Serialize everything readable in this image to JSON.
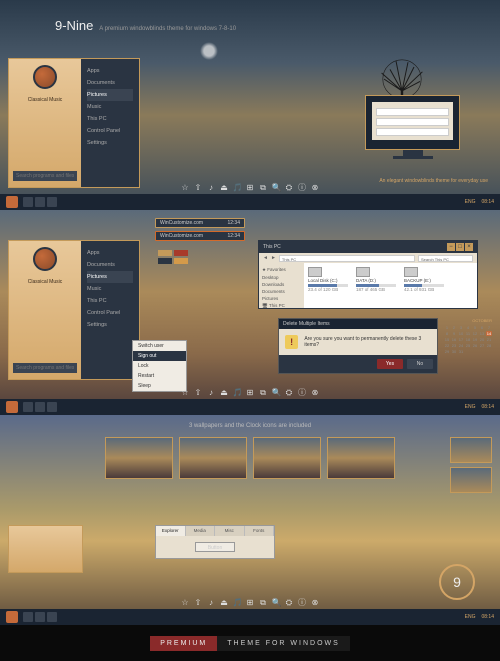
{
  "product": {
    "name": "9-Nine",
    "subtitle": "A premium windowblinds theme for windows 7-8-10"
  },
  "tagline": "An elegant windowblinds theme for everyday use",
  "startmenu": {
    "username": "Classical Music",
    "search_ph": "Search programs and files",
    "items": [
      "Apps",
      "Documents",
      "Pictures",
      "Music",
      "This PC",
      "Control Panel",
      "Settings"
    ]
  },
  "taskbar": {
    "time": "08:14",
    "lang": "ENG",
    "date_short": ""
  },
  "dock": [
    "☆",
    "⇧",
    "♪",
    "⏏",
    "🎵",
    "⊞",
    "⧉",
    "🔍",
    "⛭",
    "ⓘ",
    "⊗"
  ],
  "tabs": [
    {
      "label": "WinCustomize.com",
      "t": "12:34"
    },
    {
      "label": "WinCustomize.com",
      "t": "12:34"
    }
  ],
  "swatches": [
    [
      "#c49a5a",
      "#a83a2a"
    ],
    [
      "#2a3442",
      "#d49a4a"
    ]
  ],
  "explorer": {
    "title": "This PC",
    "address": "This PC",
    "search_ph": "Search This PC",
    "side": [
      "★ Favorites",
      "Desktop",
      "Downloads",
      "Documents",
      "Pictures",
      "🖥 This PC"
    ],
    "drives": [
      {
        "name": "Local Disk (C:)",
        "free": "23.4 of 120 GB",
        "fill": 72
      },
      {
        "name": "DATA (D:)",
        "free": "187 of 465 GB",
        "fill": 58
      },
      {
        "name": "BACKUP (E:)",
        "free": "42.1 of 931 GB",
        "fill": 45
      }
    ]
  },
  "dialog": {
    "title": "Delete Multiple Items",
    "msg": "Are you sure you want to permanently delete these 3 items?",
    "yes": "Yes",
    "no": "No"
  },
  "context": [
    "Switch user",
    "Sign out",
    "Lock",
    "Restart",
    "Sleep"
  ],
  "calendar": {
    "month": "OCTOBER",
    "days": [
      "1",
      "2",
      "3",
      "4",
      "5",
      "6",
      "7",
      "8",
      "9",
      "10",
      "11",
      "12",
      "13",
      "14",
      "15",
      "16",
      "17",
      "18",
      "19",
      "20",
      "21",
      "22",
      "23",
      "24",
      "25",
      "26",
      "27",
      "28",
      "29",
      "30",
      "31"
    ],
    "today": "14"
  },
  "section3_title": "3 wallpapers and the Clock icons are included",
  "config": {
    "tabs": [
      "Explorer",
      "Media",
      "Misc",
      "Fonts"
    ],
    "btn": "Button"
  },
  "clock_num": "9",
  "footer": {
    "left": "PREMIUM",
    "right": "THEME FOR WINDOWS"
  }
}
